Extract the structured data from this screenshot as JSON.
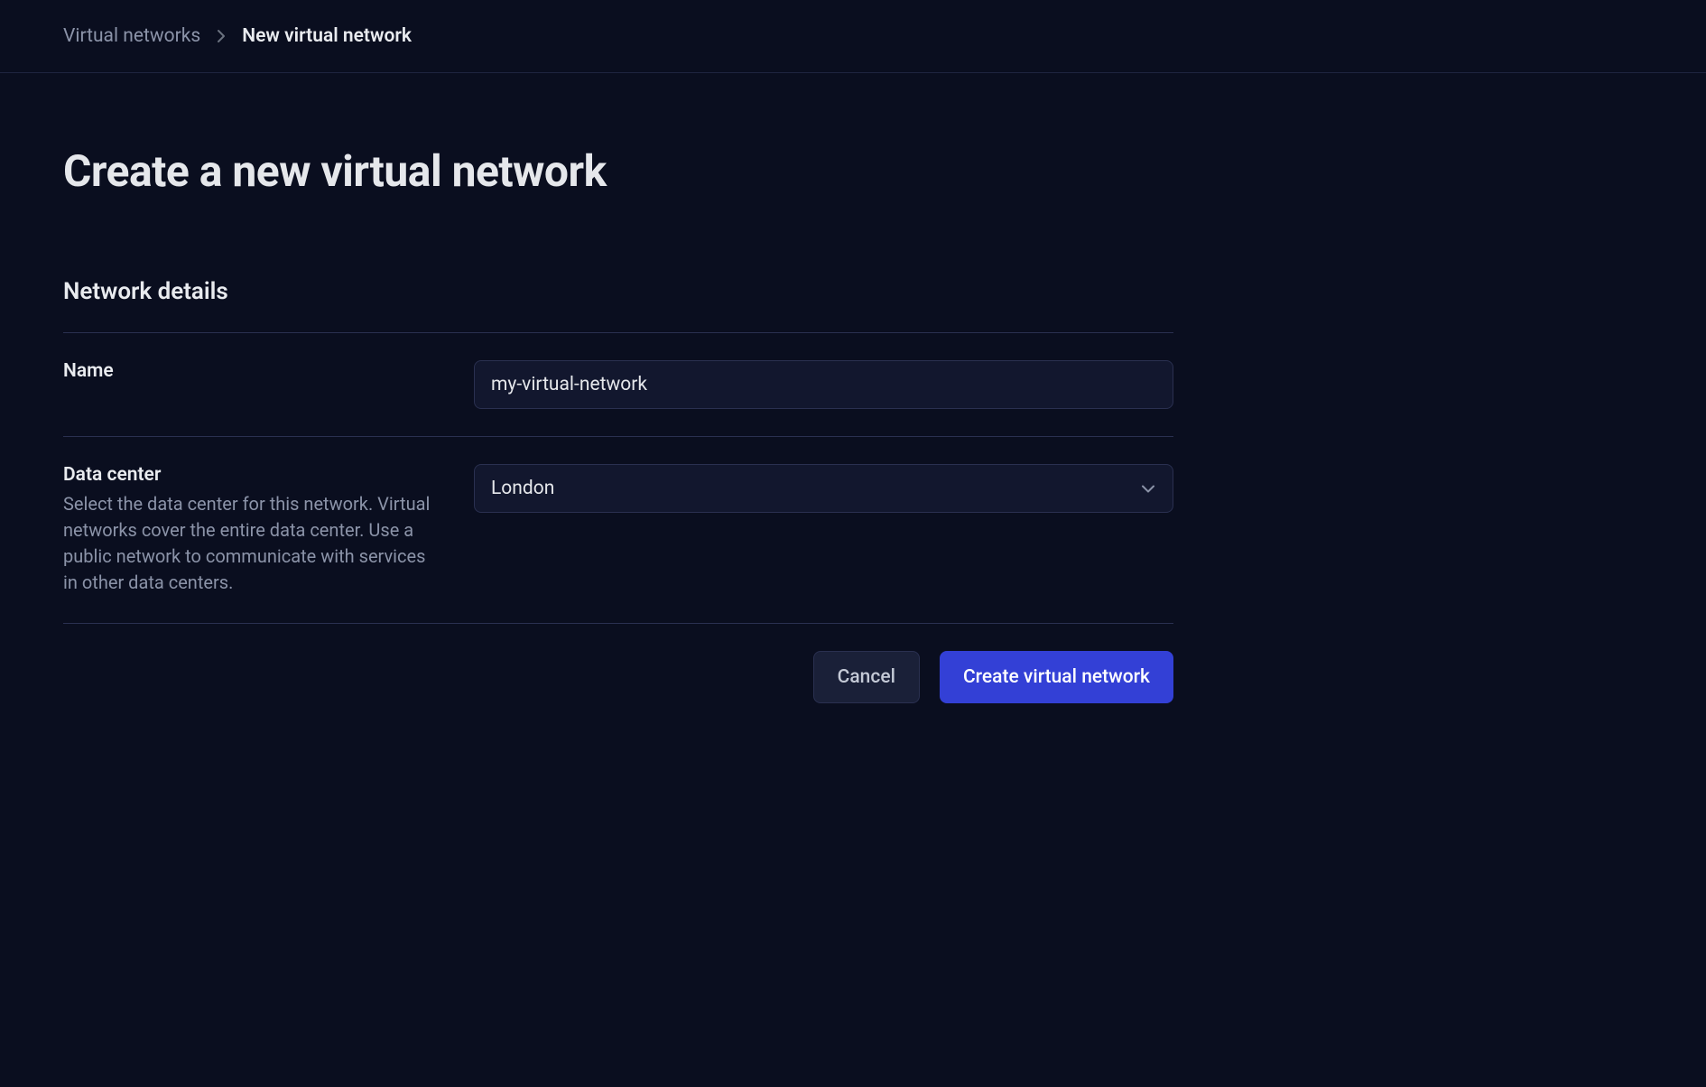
{
  "breadcrumb": {
    "parent": "Virtual networks",
    "current": "New virtual network"
  },
  "page": {
    "title": "Create a new virtual network"
  },
  "section": {
    "title": "Network details"
  },
  "form": {
    "name": {
      "label": "Name",
      "value": "my-virtual-network"
    },
    "datacenter": {
      "label": "Data center",
      "help": "Select the data center for this network. Virtual networks cover the entire data center. Use a public network to communicate with services in other data centers.",
      "value": "London"
    }
  },
  "actions": {
    "cancel": "Cancel",
    "submit": "Create virtual network"
  }
}
